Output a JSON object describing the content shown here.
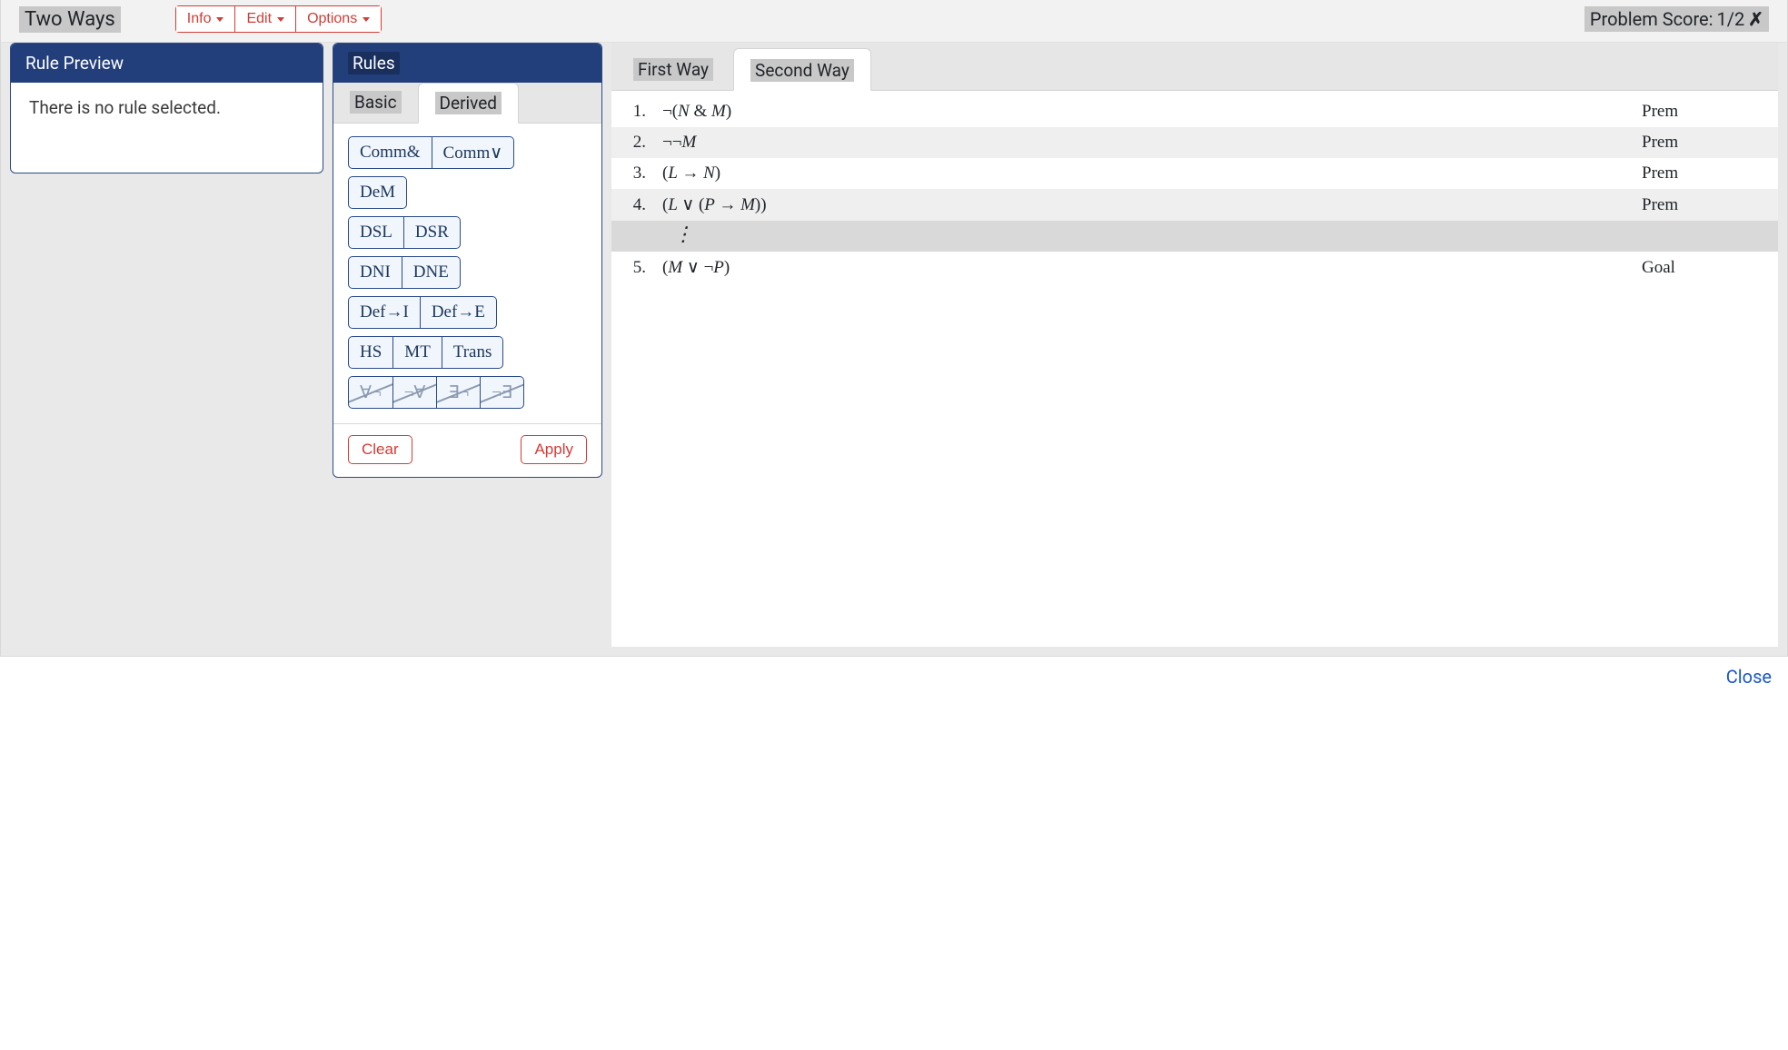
{
  "header": {
    "title": "Two Ways",
    "buttons": {
      "info": "Info",
      "edit": "Edit",
      "options": "Options"
    },
    "score_label": "Problem Score:",
    "score_value": "1/2",
    "score_x": "✗"
  },
  "preview": {
    "title": "Rule Preview",
    "body": "There is no rule selected."
  },
  "rules": {
    "title": "Rules",
    "tabs": {
      "basic": "Basic",
      "derived": "Derived",
      "active": "derived"
    },
    "rows": [
      [
        {
          "label": "Comm&",
          "disabled": false
        },
        {
          "label": "Comm∨",
          "disabled": false
        }
      ],
      [
        {
          "label": "DeM",
          "disabled": false
        }
      ],
      [
        {
          "label": "DSL",
          "disabled": false
        },
        {
          "label": "DSR",
          "disabled": false
        }
      ],
      [
        {
          "label": "DNI",
          "disabled": false
        },
        {
          "label": "DNE",
          "disabled": false
        }
      ],
      [
        {
          "label": "Def→I",
          "disabled": false
        },
        {
          "label": "Def→E",
          "disabled": false
        }
      ],
      [
        {
          "label": "HS",
          "disabled": false
        },
        {
          "label": "MT",
          "disabled": false
        },
        {
          "label": "Trans",
          "disabled": false
        }
      ],
      [
        {
          "label": "∀¬",
          "disabled": true
        },
        {
          "label": "¬∀",
          "disabled": true
        },
        {
          "label": "∃¬",
          "disabled": true
        },
        {
          "label": "¬∃",
          "disabled": true
        }
      ]
    ],
    "clear": "Clear",
    "apply": "Apply"
  },
  "proof": {
    "tabs": {
      "first": "First Way",
      "second": "Second Way",
      "active": "second"
    },
    "lines": [
      {
        "n": "1.",
        "formula_html": "<span class='op'>¬(</span>N <span class='op'>&amp;</span> M<span class='op'>)</span>",
        "just": "Prem",
        "alt": false
      },
      {
        "n": "2.",
        "formula_html": "<span class='op'>¬¬</span>M",
        "just": "Prem",
        "alt": true
      },
      {
        "n": "3.",
        "formula_html": "<span class='op'>(</span>L <span class='op'>→</span> N<span class='op'>)</span>",
        "just": "Prem",
        "alt": false
      },
      {
        "n": "4.",
        "formula_html": "<span class='op'>(</span>L <span class='op'>∨ (</span>P <span class='op'>→</span> M<span class='op'>))</span>",
        "just": "Prem",
        "alt": true
      },
      {
        "n": "",
        "formula_html": "<span class='vdots'>⋮</span>",
        "just": "",
        "dots": true
      },
      {
        "n": "5.",
        "formula_html": "<span class='op'>(</span>M <span class='op'>∨ ¬</span>P<span class='op'>)</span>",
        "just": "Goal",
        "alt": false
      }
    ]
  },
  "footer": {
    "close": "Close"
  }
}
